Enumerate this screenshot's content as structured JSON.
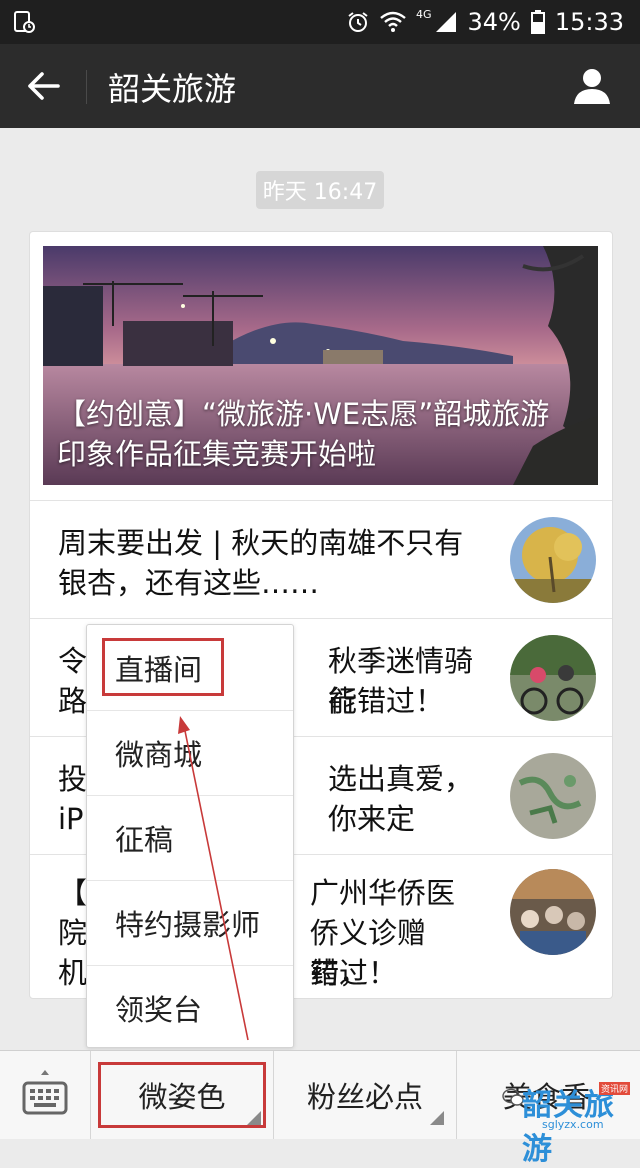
{
  "status_bar": {
    "network": "4G",
    "battery": "34%",
    "time": "15:33",
    "icons": [
      "screen-record-icon",
      "alarm-icon",
      "wifi-icon",
      "signal-icon",
      "battery-icon"
    ]
  },
  "header": {
    "title": "韶关旅游",
    "back_icon": "back-arrow-icon",
    "profile_icon": "person-icon"
  },
  "timestamp": "昨天 16:47",
  "article_card": {
    "hero": {
      "title_line1": "【约创意】“微旅游·WE志愿”韶城旅游",
      "title_line2": "印象作品征集竞赛开始啦"
    },
    "items": [
      {
        "line1": "周末要出发 | 秋天的南雄不只有",
        "line2": "银杏，还有这些……"
      },
      {
        "line1": "令",
        "line1b": "秋季迷情骑行",
        "line2": "路",
        "line2b": "能错过！"
      },
      {
        "line1": "投",
        "line1b": "选出真爱，",
        "line2": "iP",
        "line2b": "你来定"
      },
      {
        "line1": "【",
        "line1b": "广州华侨医",
        "line2": "院",
        "line2b": "侨义诊赠药，",
        "line3": "机",
        "line3b": "错过！"
      }
    ]
  },
  "popup_menu": {
    "items": [
      "直播间",
      "微商城",
      "征稿",
      "特约摄影师",
      "领奖台"
    ]
  },
  "bottom_menu": {
    "keyboard_icon": "keyboard-icon",
    "tabs": [
      "微姿色",
      "粉丝必点",
      "美食香"
    ]
  },
  "watermark": {
    "text": "韶关旅游",
    "sub": "sglyzx.com",
    "tag": "资讯网"
  },
  "colors": {
    "highlight": "#c83a3a",
    "header_bg": "#2c2c2c",
    "page_bg": "#ebebeb"
  }
}
